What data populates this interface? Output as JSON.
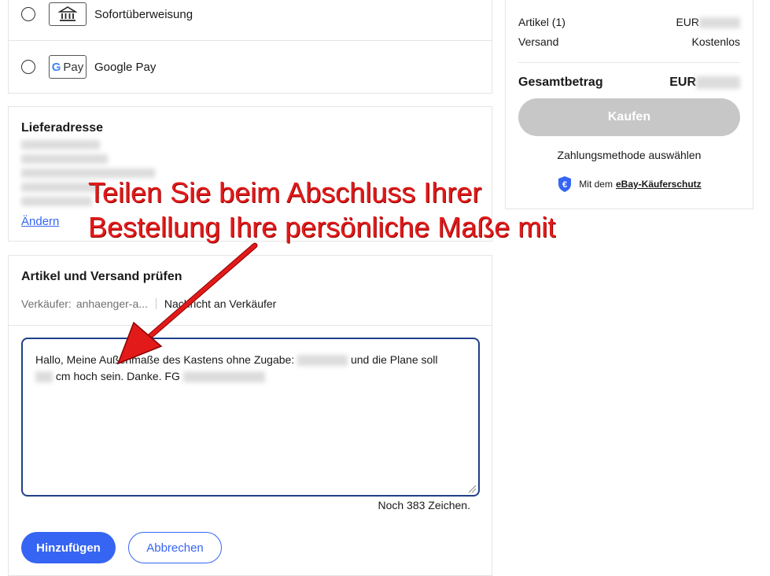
{
  "payment": {
    "options": [
      {
        "label": "Sofortüberweisung",
        "icon": "bank-icon"
      },
      {
        "label": "Google Pay",
        "logo": "Pay"
      }
    ]
  },
  "address": {
    "title": "Lieferadresse",
    "change_link": "Ändern"
  },
  "review": {
    "title": "Artikel und Versand prüfen",
    "seller_label": "Verkäufer:",
    "seller_name": "anhaenger-a...",
    "message_link": "Nachricht an Verkäufer",
    "message_line1_a": "Hallo, Meine Außenmaße des Kastens ohne Zugabe:",
    "message_line1_b": "und die Plane soll",
    "message_line2_a": "cm hoch sein. Danke. FG",
    "char_counter": "Noch 383 Zeichen.",
    "add_button": "Hinzufügen",
    "cancel_button": "Abbrechen"
  },
  "summary": {
    "items_label": "Artikel (1)",
    "items_currency": "EUR",
    "shipping_label": "Versand",
    "shipping_value": "Kostenlos",
    "total_label": "Gesamtbetrag",
    "total_currency": "EUR",
    "buy_button": "Kaufen",
    "hint": "Zahlungsmethode auswählen",
    "protection_prefix": "Mit dem",
    "protection_link": "eBay-Käuferschutz",
    "protection_icon": "euro-shield-icon"
  },
  "annotation": {
    "line1": "Teilen Sie beim Abschluss Ihrer",
    "line2": "Bestellung Ihre persönliche Maße mit",
    "color": "#e31a1a"
  },
  "colors": {
    "accent": "#3665f3",
    "disabled_button": "#c7c7c7"
  }
}
